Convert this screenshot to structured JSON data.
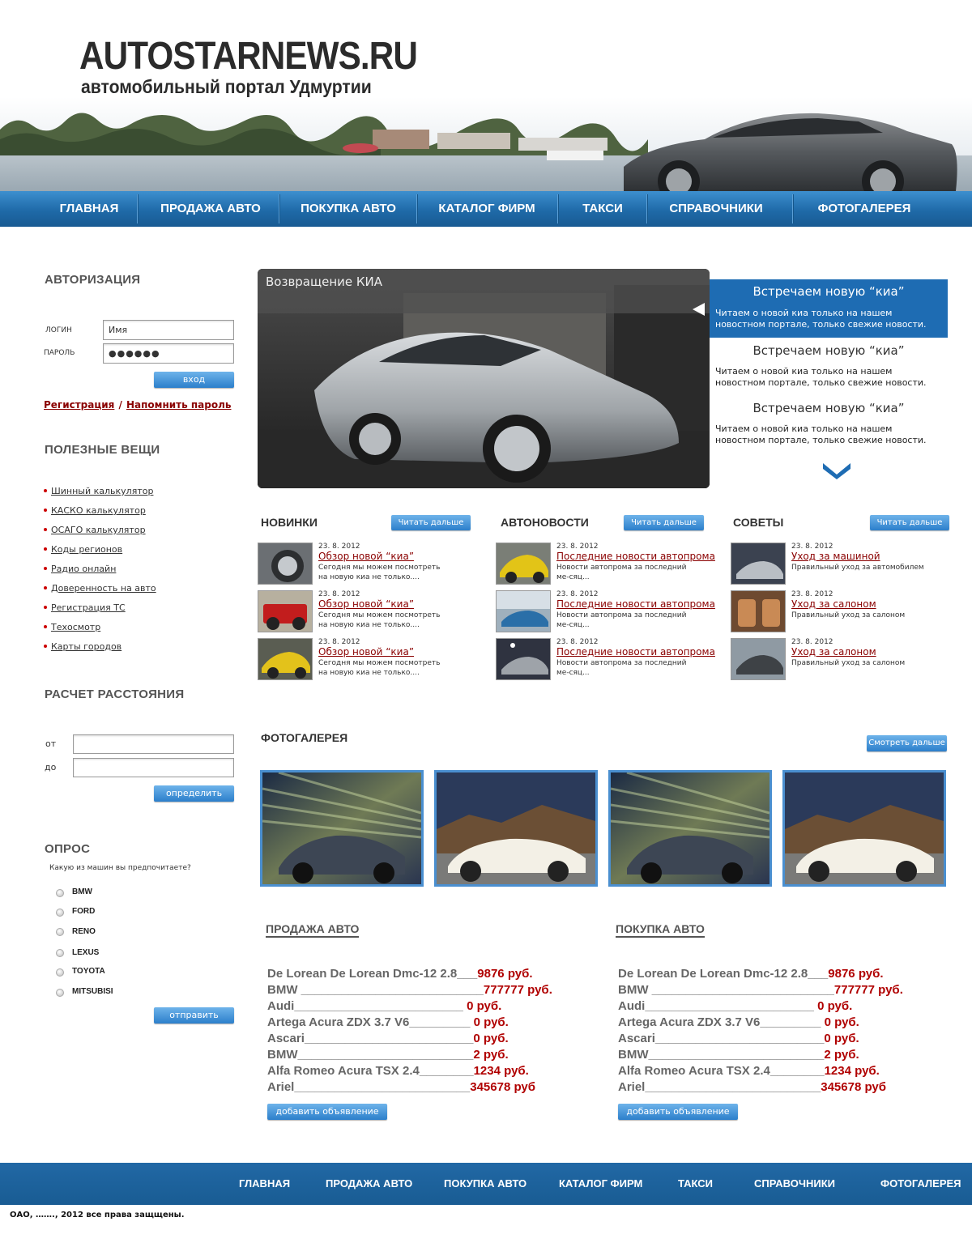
{
  "header": {
    "title": "AUTOSTARNEWS.RU",
    "subtitle": "автомобильный портал Удмуртии"
  },
  "nav": [
    "ГЛАВНАЯ",
    "ПРОДАЖА АВТО",
    "ПОКУПКА АВТО",
    "КАТАЛОГ ФИРМ",
    "ТАКСИ",
    "СПРАВОЧНИКИ",
    "ФОТОГАЛЕРЕЯ"
  ],
  "auth": {
    "heading": "АВТОРИЗАЦИЯ",
    "login_label": "ЛОГИН",
    "login_value": "Имя",
    "password_label": "ПАРОЛЬ",
    "password_value": "●●●●●●",
    "submit": "вход",
    "register": "Регистрация",
    "separator": "/",
    "remind": "Напомнить пароль"
  },
  "useful": {
    "heading": "ПОЛЕЗНЫЕ ВЕЩИ",
    "items": [
      "Шинный калькулятор",
      "КАСКО калькулятор",
      "ОСАГО калькулятор",
      "Коды регионов",
      "Радио онлайн",
      "Доверенность на авто",
      "Регистрация ТС",
      "Техосмотр",
      "Карты городов"
    ]
  },
  "distance": {
    "heading": "РАСЧЕТ РАССТОЯНИЯ",
    "from_label": "от",
    "to_label": "до",
    "submit": "определить"
  },
  "poll": {
    "heading": "ОПРОС",
    "question": "Какую из машин вы предпочитаете?",
    "options": [
      "BMW",
      "FORD",
      "RENO",
      "LEXUS",
      "TOYOTA",
      "MITSUBISI"
    ],
    "submit": "отправить"
  },
  "slider": {
    "title": "Возвращение КИА",
    "news": [
      {
        "title": "Встречаем новую  “киа”",
        "text": "Читаем  о новой киа только на нашем новостном портале, только свежие новости."
      },
      {
        "title": "Встречаем новую  “киа”",
        "text": "Читаем  о новой киа только на нашем новостном портале, только свежие новости."
      },
      {
        "title": "Встречаем новую  “киа”",
        "text": "Читаем  о новой киа только на нашем новостном портале, только свежие новости."
      }
    ]
  },
  "sections": [
    {
      "heading": "НОВИНКИ",
      "button": "Читать дальше",
      "items": [
        {
          "date": "23. 8. 2012",
          "title": "Обзор новой “киа”",
          "text": "Сегодня мы можем посмотреть на новую киа не только...."
        },
        {
          "date": "23. 8. 2012",
          "title": "Обзор новой “киа”",
          "text": "Сегодня мы можем посмотреть на новую киа не только...."
        },
        {
          "date": "23. 8. 2012",
          "title": "Обзор новой “киа”",
          "text": "Сегодня мы можем посмотреть на новую киа не только...."
        }
      ]
    },
    {
      "heading": "АВТОНОВОСТИ",
      "button": "Читать дальше",
      "items": [
        {
          "date": "23. 8. 2012",
          "title": "Последние новости автопрома",
          "text": "Новости автопрома за последний ме-сяц..."
        },
        {
          "date": "23. 8. 2012",
          "title": "Последние новости автопрома",
          "text": "Новости автопрома за последний ме-сяц..."
        },
        {
          "date": "23. 8. 2012",
          "title": "Последние новости автопрома",
          "text": "Новости автопрома за последний ме-сяц..."
        }
      ]
    },
    {
      "heading": "СОВЕТЫ",
      "button": "Читать дальше",
      "items": [
        {
          "date": "23. 8. 2012",
          "title": "Уход за машиной",
          "text": "Правильный уход за автомобилем"
        },
        {
          "date": "23. 8. 2012",
          "title": "Уход за салоном ",
          "text": "Правильный уход за салоном"
        },
        {
          "date": "23. 8. 2012",
          "title": "Уход за салоном ",
          "text": "Правильный уход за салоном"
        }
      ]
    }
  ],
  "gallery": {
    "heading": "ФОТОГАЛЕРЕЯ",
    "button": "Смотреть дальше"
  },
  "market": [
    {
      "heading": "ПРОДАЖА АВТО",
      "button": "добавить объявление",
      "rows": [
        {
          "name": "De Lorean De Lorean Dmc-12 2.8___",
          "price": "9876 руб."
        },
        {
          "name": "BMW ___________________________",
          "price": "777777 руб."
        },
        {
          "name": "Audi_________________________ ",
          "price": " 0 руб."
        },
        {
          "name": "Artega Acura ZDX 3.7 V6_________ ",
          "price": " 0 руб."
        },
        {
          "name": "Ascari_________________________",
          "price": "0 руб."
        },
        {
          "name": "BMW__________________________",
          "price": "2 руб."
        },
        {
          "name": "Alfa Romeo Acura TSX 2.4________",
          "price": "1234 руб."
        },
        {
          "name": "Ariel__________________________",
          "price": "345678 руб"
        }
      ]
    },
    {
      "heading": "ПОКУПКА АВТО",
      "button": "добавить объявление",
      "rows": [
        {
          "name": "De Lorean De Lorean Dmc-12 2.8___",
          "price": "9876 руб."
        },
        {
          "name": "BMW ___________________________",
          "price": "777777 руб."
        },
        {
          "name": "Audi_________________________ ",
          "price": " 0 руб."
        },
        {
          "name": "Artega Acura ZDX 3.7 V6_________ ",
          "price": " 0 руб."
        },
        {
          "name": "Ascari_________________________",
          "price": "0 руб."
        },
        {
          "name": "BMW__________________________",
          "price": "2 руб."
        },
        {
          "name": "Alfa Romeo Acura TSX 2.4________",
          "price": "1234 руб."
        },
        {
          "name": "Ariel__________________________",
          "price": "345678 руб"
        }
      ]
    }
  ],
  "footer": {
    "nav": [
      "ГЛАВНАЯ",
      "ПРОДАЖА АВТО",
      "ПОКУПКА АВТО",
      "КАТАЛОГ ФИРМ",
      "ТАКСИ",
      "СПРАВОЧНИКИ",
      "ФОТОГАЛЕРЕЯ"
    ],
    "copyright": "ОАО, ……., 2012 все права защщены."
  }
}
